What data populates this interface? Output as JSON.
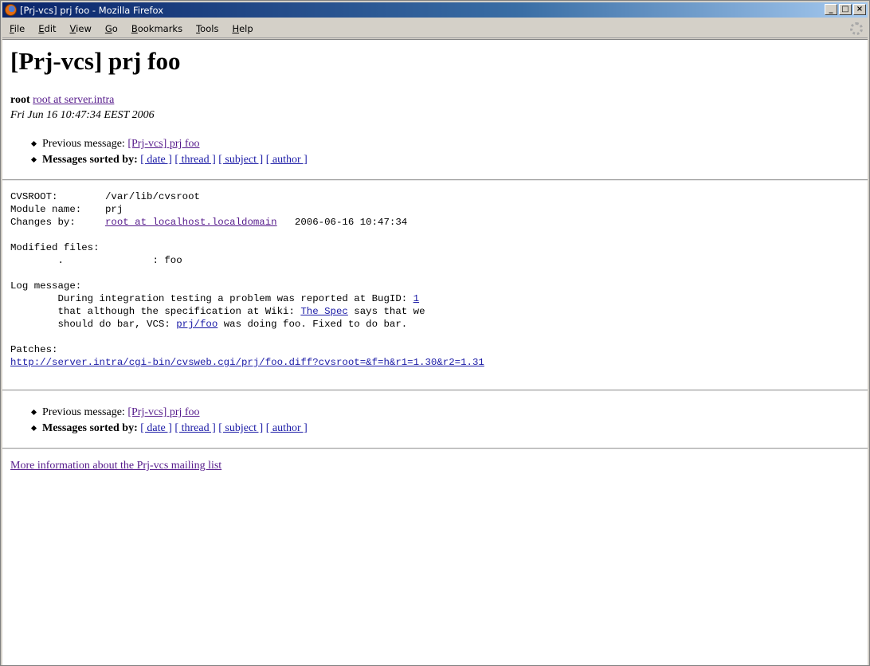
{
  "window": {
    "title": "[Prj-vcs] prj foo - Mozilla Firefox",
    "buttons": {
      "minimize": "_",
      "maximize": "□",
      "close": "×"
    }
  },
  "menubar": {
    "items": [
      {
        "label": "File",
        "key": "F",
        "rest": "ile"
      },
      {
        "label": "Edit",
        "key": "E",
        "rest": "dit"
      },
      {
        "label": "View",
        "key": "V",
        "rest": "iew"
      },
      {
        "label": "Go",
        "key": "G",
        "rest": "o"
      },
      {
        "label": "Bookmarks",
        "key": "B",
        "rest": "ookmarks"
      },
      {
        "label": "Tools",
        "key": "T",
        "rest": "ools"
      },
      {
        "label": "Help",
        "key": "H",
        "rest": "elp"
      }
    ]
  },
  "page": {
    "heading": "[Prj-vcs] prj foo",
    "author_name": "root",
    "author_email": "root at server.intra ",
    "date": "Fri Jun 16 10:47:34 EEST 2006",
    "nav": {
      "previous_label": "Previous message: ",
      "previous_link": "[Prj-vcs] prj foo",
      "sorted_label": "Messages sorted by: ",
      "sort_links": [
        "[ date ]",
        "[ thread ]",
        "[ subject ]",
        "[ author ]"
      ]
    },
    "body": {
      "cvsroot_label": "CVSROOT:        ",
      "cvsroot_value": "/var/lib/cvsroot",
      "module_label": "Module name:    ",
      "module_value": "prj",
      "changes_label": "Changes by:     ",
      "changes_link": "root at localhost.localdomain",
      "changes_date": "   2006-06-16 10:47:34",
      "modified_label": "Modified files:",
      "modified_line": "        .               : foo",
      "log_label": "Log message:",
      "log_line1_pre": "        During integration testing a problem was reported at BugID: ",
      "log_bugid": "1",
      "log_line2_pre": "        that although the specification at Wiki: ",
      "log_wiki": "The Spec",
      "log_line2_post": " says that we",
      "log_line3_pre": "        should do bar, VCS: ",
      "log_vcs": "prj/foo",
      "log_line3_post": " was doing foo. Fixed to do bar.",
      "patches_label": "Patches:",
      "patches_link": "http://server.intra/cgi-bin/cvsweb.cgi/prj/foo.diff?cvsroot=&f=h&r1=1.30&r2=1.31"
    },
    "more_info": "More information about the Prj-vcs mailing list"
  }
}
